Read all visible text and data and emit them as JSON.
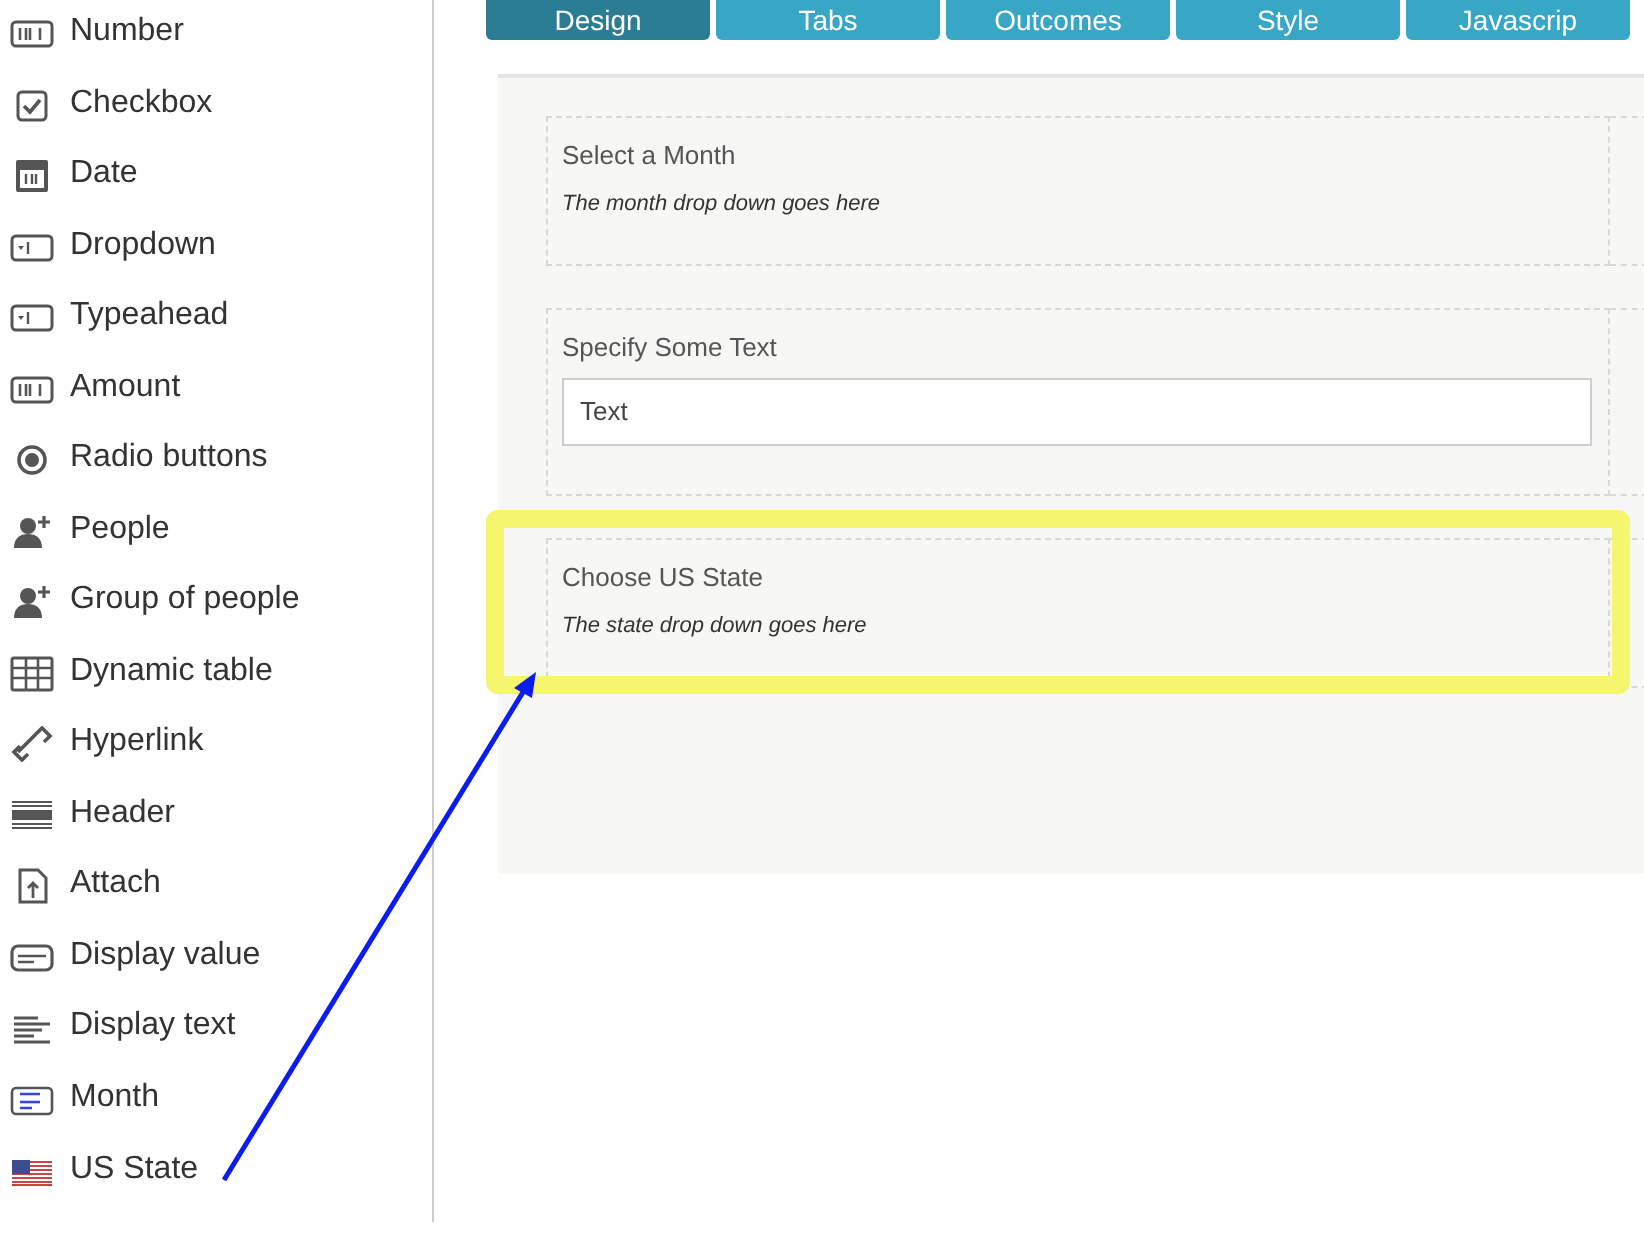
{
  "palette": [
    {
      "label": "Number",
      "kind": "number"
    },
    {
      "label": "Checkbox",
      "kind": "checkbox"
    },
    {
      "label": "Date",
      "kind": "date"
    },
    {
      "label": "Dropdown",
      "kind": "dropdown"
    },
    {
      "label": "Typeahead",
      "kind": "dropdown"
    },
    {
      "label": "Amount",
      "kind": "amount"
    },
    {
      "label": "Radio buttons",
      "kind": "radio"
    },
    {
      "label": "People",
      "kind": "person"
    },
    {
      "label": "Group of people",
      "kind": "person"
    },
    {
      "label": "Dynamic table",
      "kind": "table"
    },
    {
      "label": "Hyperlink",
      "kind": "link"
    },
    {
      "label": "Header",
      "kind": "header"
    },
    {
      "label": "Attach",
      "kind": "attach"
    },
    {
      "label": "Display value",
      "kind": "value"
    },
    {
      "label": "Display text",
      "kind": "text"
    },
    {
      "label": "Month",
      "kind": "month"
    },
    {
      "label": "US State",
      "kind": "flag"
    }
  ],
  "tabs": [
    {
      "label": "Design",
      "selected": true
    },
    {
      "label": "Tabs",
      "selected": false
    },
    {
      "label": "Outcomes",
      "selected": false
    },
    {
      "label": "Style",
      "selected": false
    },
    {
      "label": "Javascrip",
      "selected": false
    }
  ],
  "canvas": {
    "sections": [
      {
        "label": "Select a Month",
        "kind": "hint",
        "hint": "The month drop down goes here",
        "highlighted": false
      },
      {
        "label": "Specify Some Text",
        "kind": "input",
        "value": "Text",
        "highlighted": false
      },
      {
        "label": "Choose US State",
        "kind": "hint",
        "hint": "The state drop down goes here",
        "highlighted": true
      }
    ]
  }
}
